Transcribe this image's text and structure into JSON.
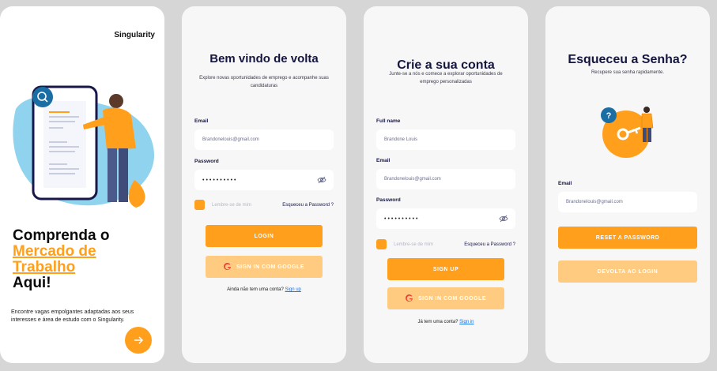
{
  "onboarding": {
    "brand": "Singularity",
    "title_line1": "Comprenda o",
    "title_highlight1": "Mercado de",
    "title_highlight2": "Trabalho",
    "title_line3": "Aqui!",
    "subtitle": "Encontre vagas empolgantes adaptadas aos seus interesses e área de estudo com o Singularity.",
    "next_icon": "arrow-right-icon",
    "search_icon": "search-icon"
  },
  "login": {
    "title": "Bem vindo de volta",
    "description": "Explore novas oportunidades de emprego e acompanhe suas candidaturas",
    "email_label": "Email",
    "email_value": "Brandonelouis@gmail.com",
    "password_label": "Password",
    "password_value": "••••••••••",
    "remember_label": "Lembre-se de mim",
    "forgot_label": "Esqueceu a Password ?",
    "login_button": "LOGIN",
    "google_button": "SIGN IN COM GOOGLE",
    "footer_text": "Ainda não tem uma conta?",
    "footer_link": "Sign up"
  },
  "signup": {
    "title": "Crie a sua conta",
    "description": "Junte-se a nós e comece a explorar oportunidades de emprego personalizadas",
    "name_label": "Full name",
    "name_value": "Brandone Louis",
    "email_label": "Email",
    "email_value": "Brandonelouis@gmail.com",
    "password_label": "Password",
    "password_value": "••••••••••",
    "remember_label": "Lembre-se de mim",
    "forgot_label": "Esqueceu a Password ?",
    "signup_button": "SIGN UP",
    "google_button": "SIGN IN COM GOOGLE",
    "footer_text": "Já tem uma conta?",
    "footer_link": "Sign in"
  },
  "forgot": {
    "title": "Esqueceu a Senha?",
    "description": "Recupere sua senha rapidamente.",
    "email_label": "Email",
    "email_value": "Brandonelouis@gmail.com",
    "reset_button": "RESET A PASSWORD",
    "back_button": "DEVOLTA AO LOGIN"
  },
  "colors": {
    "accent": "#ff9f1c",
    "accent_light": "#ffcb80",
    "navy": "#14163f",
    "link": "#1a73e8",
    "blob": "#8fd3ef"
  }
}
